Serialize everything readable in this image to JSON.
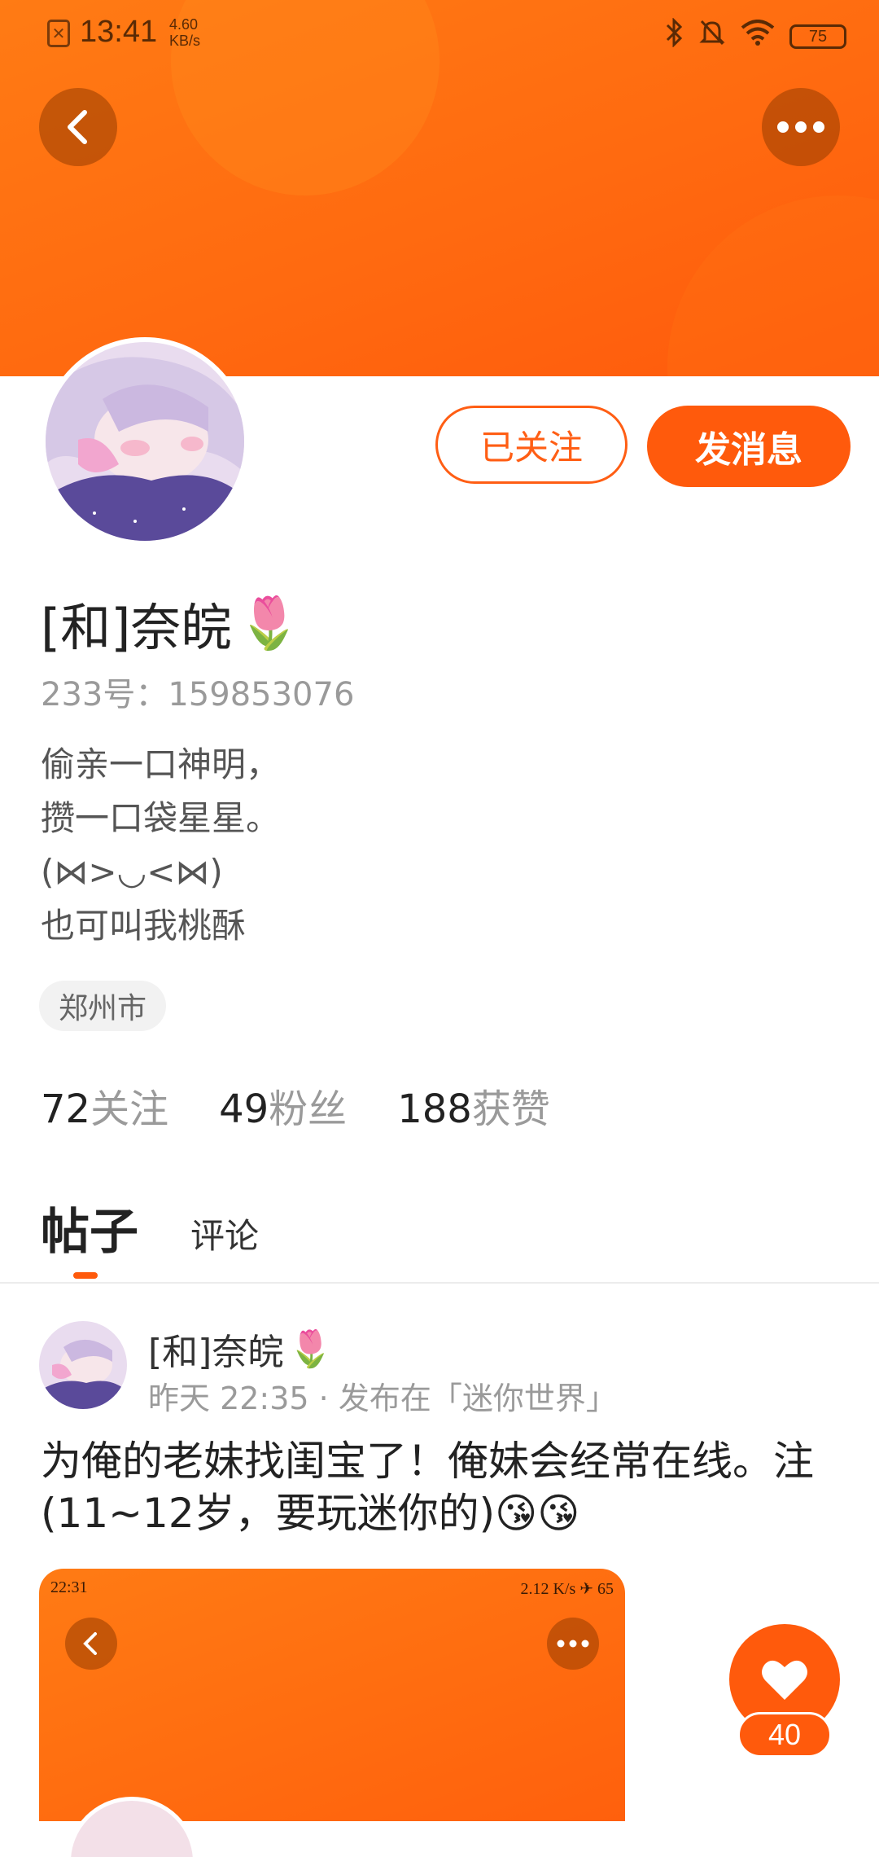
{
  "status_bar": {
    "time": "13:41",
    "speed_top": "4.60",
    "speed_bottom": "KB/s",
    "battery": "75"
  },
  "profile": {
    "username": "[和]奈皖",
    "name_emoji": "🌷",
    "id_line": "233号：159853076",
    "bio": [
      "偷亲一口神明，",
      "攒一口袋星星。",
      "(⋈>◡<⋈)",
      "也可叫我桃酥"
    ],
    "location": "郑州市",
    "follow_button": "已关注",
    "message_button": "发消息"
  },
  "stats": [
    {
      "num": "72",
      "label": "关注"
    },
    {
      "num": "49",
      "label": "粉丝"
    },
    {
      "num": "188",
      "label": "获赞"
    }
  ],
  "tabs": {
    "active": "帖子",
    "other": "评论"
  },
  "post": {
    "author": "[和]奈皖",
    "author_emoji": "🌷",
    "meta": "昨天 22:35 · 发布在「迷你世界」",
    "text": "为俺的老妹找闺宝了！俺妹会经常在线。注(11~12岁，要玩迷你的)😘😘",
    "image_status_left": "22:31",
    "image_status_right": "2.12 K/s  ✈  65",
    "like_count": "40"
  },
  "colors": {
    "brand": "#ff5a0c",
    "header": "#ff7214"
  }
}
